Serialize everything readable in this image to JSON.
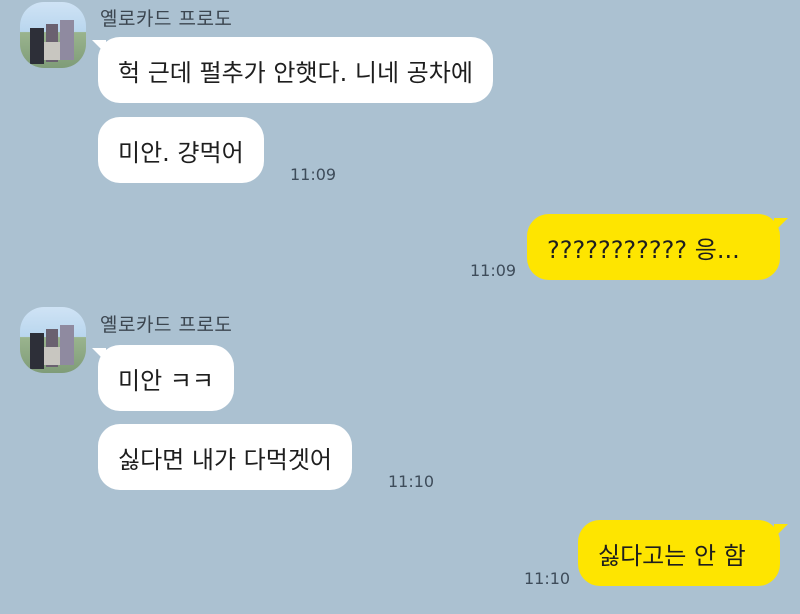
{
  "chat": {
    "group1": {
      "sender": "옐로카드 프로도",
      "messages": [
        {
          "text": "헉 근데 펄추가 안햇다. 니네 공차에"
        },
        {
          "text": "미안. 걍먹어",
          "time": "11:09"
        }
      ]
    },
    "out1": {
      "text": "??????????? 응...",
      "time": "11:09"
    },
    "group2": {
      "sender": "옐로카드 프로도",
      "messages": [
        {
          "text": "미안 ㅋㅋ"
        },
        {
          "text": "싫다면 내가 다먹겟어",
          "time": "11:10"
        }
      ]
    },
    "out2": {
      "text": "싫다고는 안 함",
      "time": "11:10"
    }
  },
  "colors": {
    "background": "#abc1d1",
    "incoming_bubble": "#ffffff",
    "outgoing_bubble": "#fee500"
  }
}
